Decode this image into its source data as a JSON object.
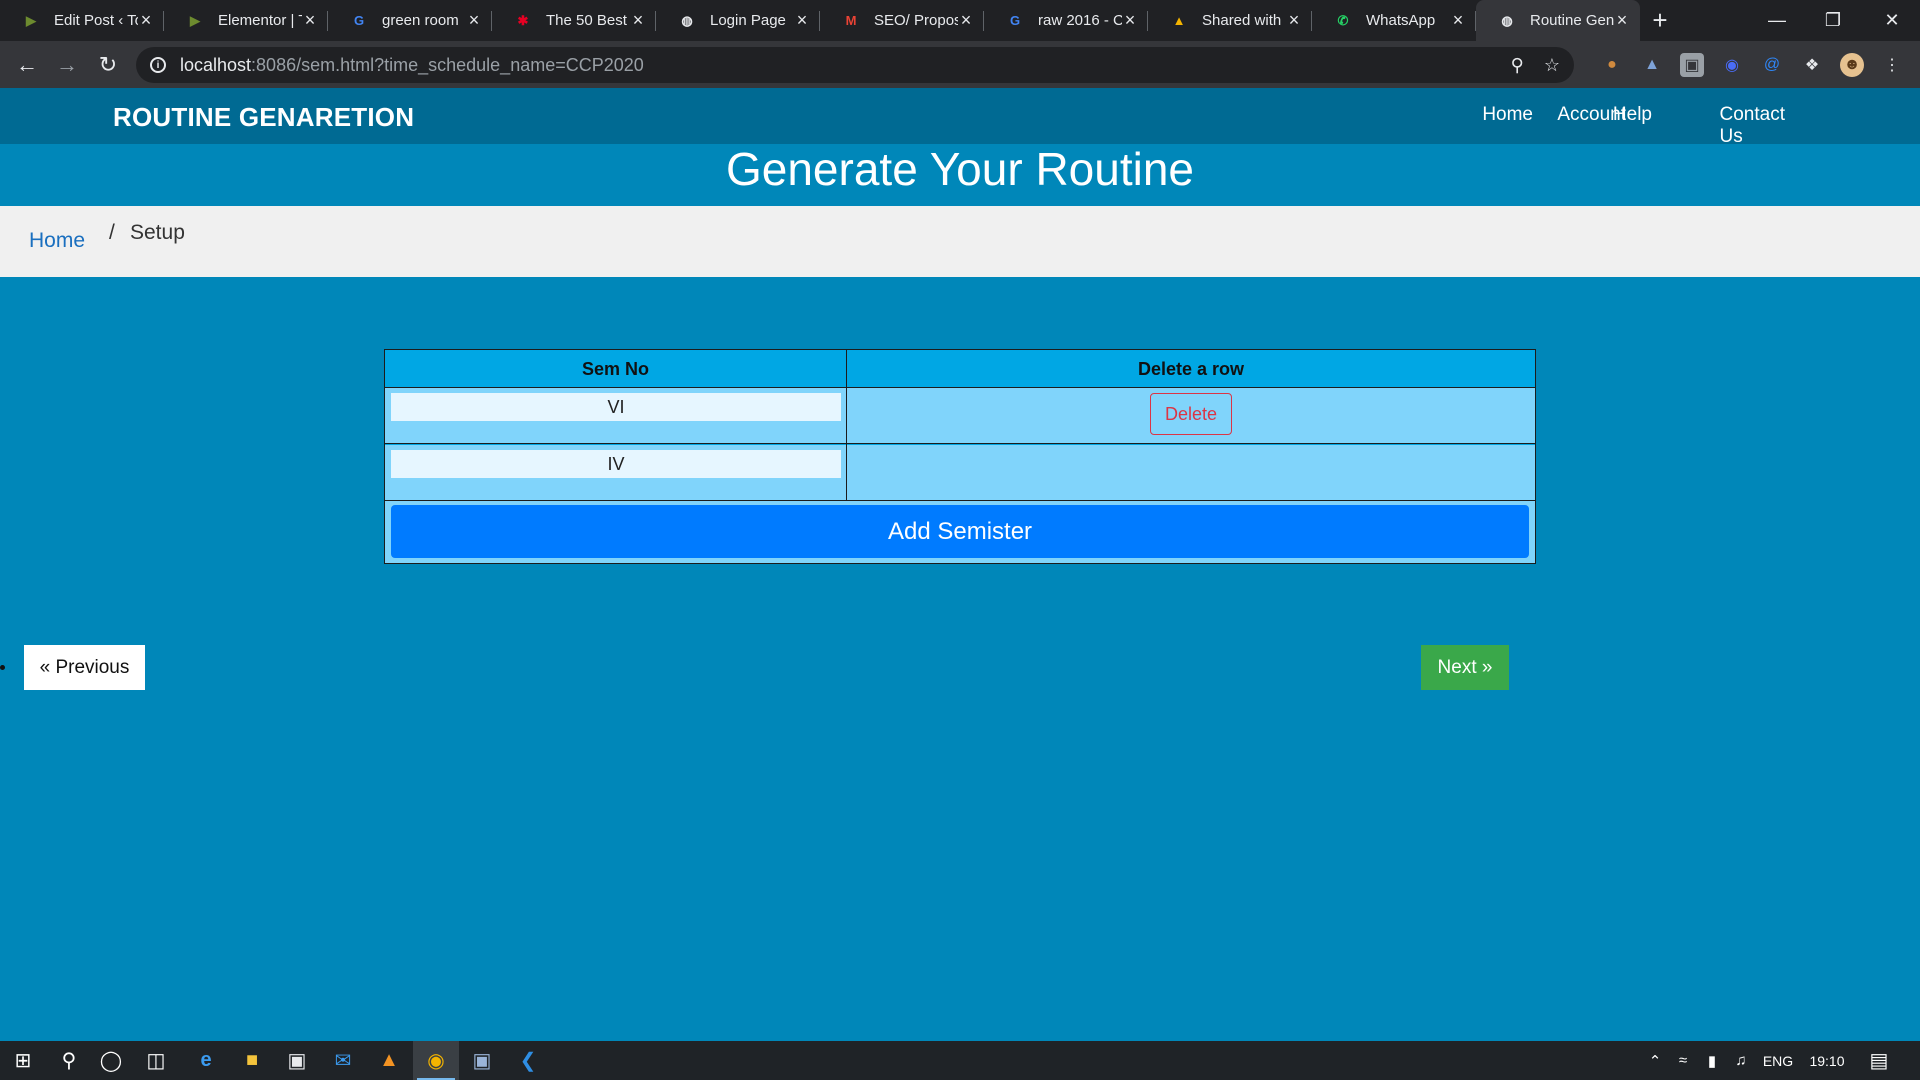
{
  "browser": {
    "tabs": [
      {
        "title": "Edit Post ‹ To",
        "icon": "elementor-icon",
        "icon_char": "▶",
        "icon_color": "#6d8b2f"
      },
      {
        "title": "Elementor | T",
        "icon": "elementor-icon",
        "icon_char": "▶",
        "icon_color": "#6d8b2f"
      },
      {
        "title": "green room",
        "icon": "google-icon",
        "icon_char": "G",
        "icon_color": "#4285f4"
      },
      {
        "title": "The 50 Best",
        "icon": "pinterest-icon",
        "icon_char": "✱",
        "icon_color": "#e60023"
      },
      {
        "title": "Login Page",
        "icon": "globe-icon",
        "icon_char": "◍",
        "icon_color": "#e8eaed"
      },
      {
        "title": "SEO/ Propos",
        "icon": "gmail-icon",
        "icon_char": "M",
        "icon_color": "#ea4335"
      },
      {
        "title": "raw 2016 - C",
        "icon": "google-icon",
        "icon_char": "G",
        "icon_color": "#4285f4"
      },
      {
        "title": "Shared with",
        "icon": "drive-icon",
        "icon_char": "▲",
        "icon_color": "#f4b400"
      },
      {
        "title": "WhatsApp",
        "icon": "whatsapp-icon",
        "icon_char": "✆",
        "icon_color": "#25d366"
      },
      {
        "title": "Routine Gen",
        "icon": "globe-icon",
        "icon_char": "◍",
        "icon_color": "#e8eaed",
        "active": true
      }
    ],
    "url_host": "localhost",
    "url_path": ":8086/sem.html?time_schedule_name=CCP2020"
  },
  "page": {
    "brand": "ROUTINE GENARETION",
    "nav": [
      {
        "label": "Home"
      },
      {
        "label": "Account"
      },
      {
        "label": "Help"
      },
      {
        "label": "Contact Us"
      }
    ],
    "hero_title": "Generate Your Routine",
    "breadcrumb": {
      "home": "Home",
      "separator": "/",
      "current": "Setup"
    },
    "table": {
      "headers": [
        "Sem No",
        "Delete a row"
      ],
      "rows": [
        {
          "sem": "VI",
          "delete_label": "Delete"
        },
        {
          "sem": "IV",
          "delete_label": ""
        }
      ],
      "add_label": "Add Semister"
    },
    "prev_label": "« Previous",
    "next_label": "Next »",
    "colors": {
      "page_bg": "#0087b9",
      "navbar": "#006a93",
      "table_header": "#00a7e4",
      "table_row": "#80d4fb",
      "add_button": "#007bff",
      "delete_button": "#dc3545",
      "next_button": "#3aa84a"
    }
  },
  "taskbar": {
    "language": "ENG",
    "time": "19:10"
  }
}
